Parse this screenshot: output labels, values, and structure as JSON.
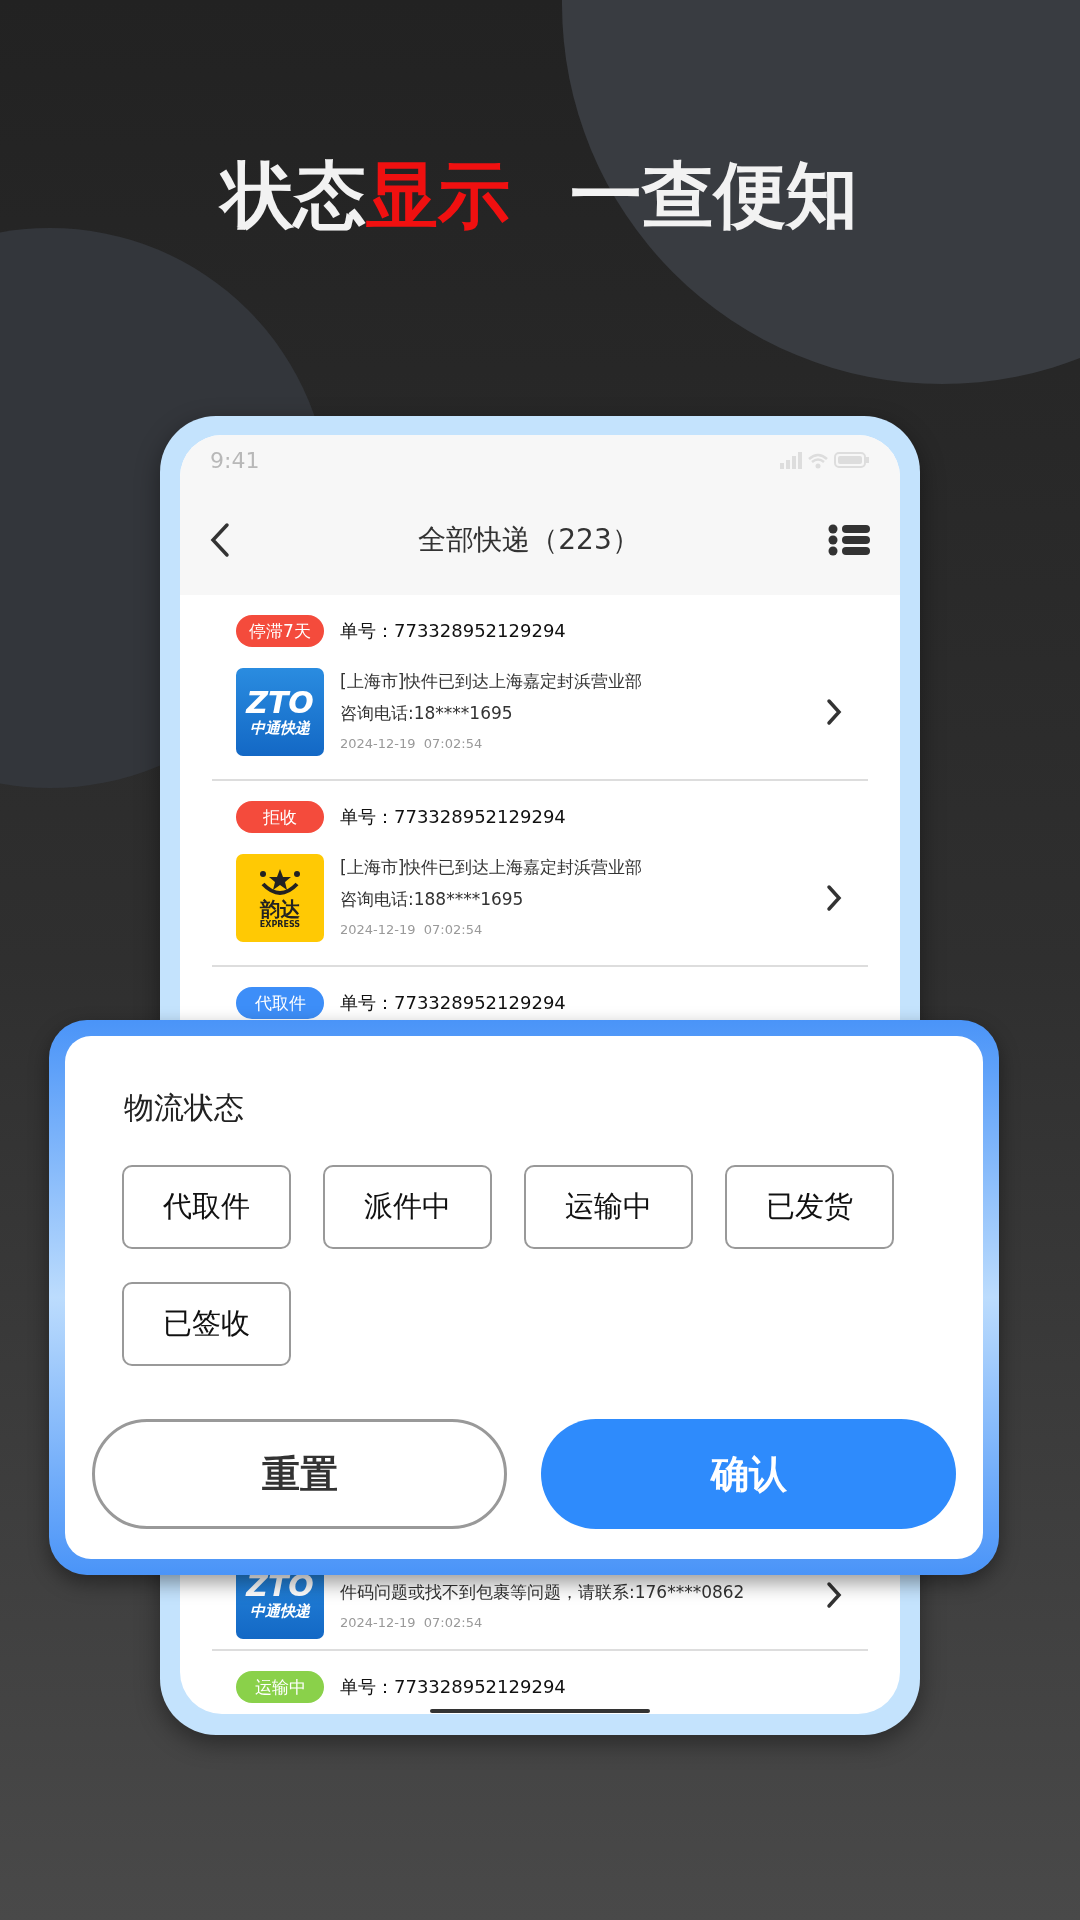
{
  "headline": {
    "left": [
      {
        "text": "状态",
        "highlight": false
      },
      {
        "text": "显示",
        "highlight": true
      }
    ],
    "right": "一查便知"
  },
  "status_bar": {
    "time": "9:41"
  },
  "nav": {
    "title": "全部快递（223）"
  },
  "parcels": [
    {
      "tag": "停滞7天",
      "color": "#f44b3c",
      "number": "单号：773328952129294",
      "logo": {
        "kind": "zto",
        "mark": "ZTO",
        "name": "中通快递"
      },
      "lines": [
        "[上海市]快件已到达上海嘉定封浜营业部",
        "咨询电话:18****1695"
      ],
      "time": "2024-12-19  07:02:54"
    },
    {
      "tag": "拒收",
      "color": "#f44b3c",
      "number": "单号：773328952129294",
      "logo": {
        "kind": "yunda",
        "name": "韵达",
        "mark": "EXPRESS"
      },
      "lines": [
        "[上海市]快件已到达上海嘉定封浜营业部",
        "咨询电话:188****1695"
      ],
      "time": "2024-12-19  07:02:54"
    },
    {
      "tag": "代取件",
      "color": "#3d8ef8",
      "number": "单号：773328952129294"
    },
    {
      "logo": {
        "kind": "zto",
        "mark": "ZTO",
        "name": "中通快递"
      },
      "lines": [
        "件码问题或找不到包裹等问题，请联系:176****0862"
      ],
      "time": "2024-12-19  07:02:54"
    },
    {
      "tag": "运输中",
      "color": "#8ad14a",
      "number": "单号：773328952129294"
    }
  ],
  "filter": {
    "title": "物流状态",
    "options": [
      "代取件",
      "派件中",
      "运输中",
      "已发货",
      "已签收"
    ],
    "buttons": [
      {
        "kind": "reset",
        "label": "重置"
      },
      {
        "kind": "confirm",
        "label": "确认"
      }
    ]
  }
}
